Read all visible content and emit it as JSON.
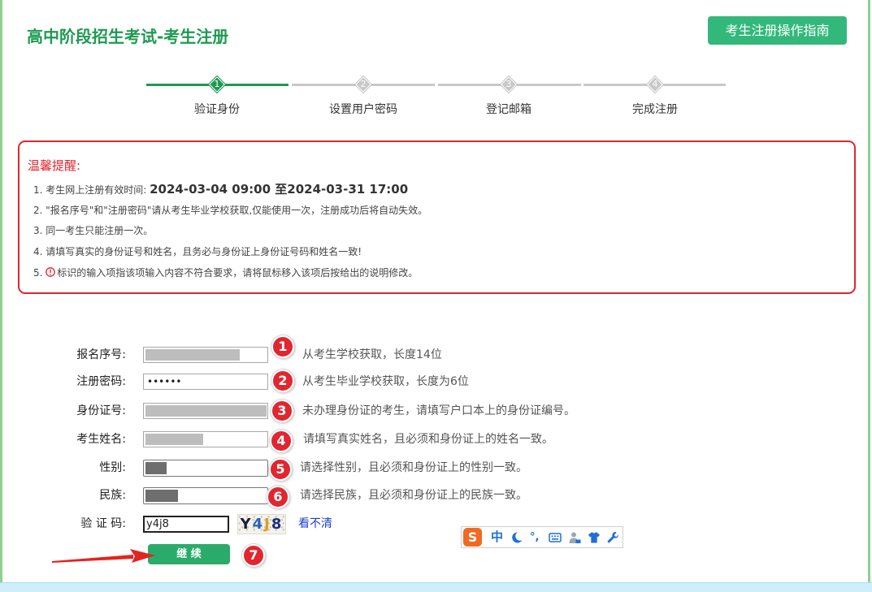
{
  "header": {
    "title": "高中阶段招生考试-考生注册",
    "guide_button": "考生注册操作指南"
  },
  "steps": [
    {
      "num": "1",
      "label": "验证身份",
      "active": true
    },
    {
      "num": "2",
      "label": "设置用户密码",
      "active": false
    },
    {
      "num": "3",
      "label": "登记邮箱",
      "active": false
    },
    {
      "num": "4",
      "label": "完成注册",
      "active": false
    }
  ],
  "notice": {
    "title": "温馨提醒:",
    "items": [
      {
        "prefix": "1. 考生网上注册有效时间: ",
        "emphasis": "2024-03-04 09:00 至2024-03-31 17:00"
      },
      {
        "text": "2. \"报名序号\"和\"注册密码\"请从考生毕业学校获取,仅能使用一次，注册成功后将自动失效。"
      },
      {
        "text": "3. 同一考生只能注册一次。"
      },
      {
        "text": "4. 请填写真实的身份证号和姓名，且务必与身份证上身份证号码和姓名一致!"
      },
      {
        "prefix": "5. ",
        "icon": "error-circle-icon",
        "text": "标识的输入项指该项输入内容不符合要求，请将鼠标移入该项后按给出的说明修改。"
      }
    ]
  },
  "form": {
    "fields": [
      {
        "label": "报名序号:",
        "hint": "从考生学校获取，长度14位"
      },
      {
        "label": "注册密码:",
        "value": "••••••",
        "hint": "从考生毕业学校获取，长度为6位"
      },
      {
        "label": "身份证号:",
        "hint": "未办理身份证的考生，请填写户口本上的身份证编号。"
      },
      {
        "label": "考生姓名:",
        "hint": "请填写真实姓名，且必须和身份证上的姓名一致。"
      },
      {
        "label": "性别:",
        "hint": "请选择性别，且必须和身份证上的性别一致。"
      },
      {
        "label": "民族:",
        "hint": "请选择民族，且必须和身份证上的民族一致。"
      }
    ],
    "captcha": {
      "label": "验 证 码:",
      "value": "y4j8",
      "image_chars": [
        "Y",
        "4",
        "J",
        "8"
      ],
      "refresh_link": "看不清"
    },
    "submit": "继 续"
  },
  "annotations": [
    "1",
    "2",
    "3",
    "4",
    "5",
    "6",
    "7"
  ],
  "ime": {
    "logo": "S",
    "mode": "中",
    "punct": "°,",
    "icons": [
      "moon-icon",
      "keyboard-icon",
      "person-icon",
      "shirt-icon",
      "wrench-icon"
    ]
  },
  "colors": {
    "brand_green": "#1e9a52",
    "button_green": "#2aab6b",
    "alert_red": "#e1262f",
    "link_blue": "#1c3fcf",
    "step_gray": "#c8c8c8"
  }
}
